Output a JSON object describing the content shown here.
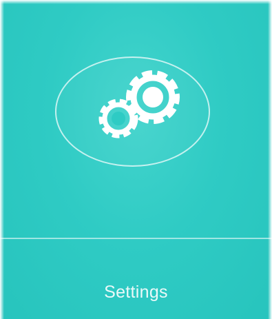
{
  "app": {
    "label": "Settings",
    "icon": "settings-gears-icon",
    "background_color": "#2fcbc4",
    "foreground_color": "#ffffff"
  }
}
